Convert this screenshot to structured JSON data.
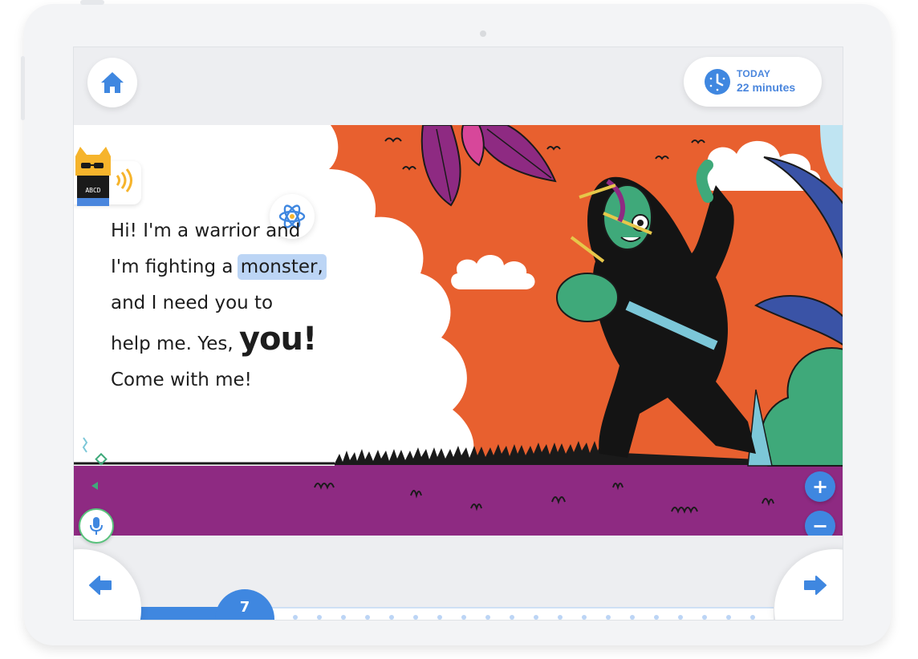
{
  "header": {
    "home_icon": "home-icon",
    "timer": {
      "label": "TODAY",
      "value": "22 minutes",
      "icon": "clock-icon"
    }
  },
  "story": {
    "lines": [
      "Hi! I'm a warrior and",
      "I'm fighting a",
      "and I need you to",
      "help me. Yes,",
      "Come with me!"
    ],
    "highlighted_word": "monster,",
    "emphasis_word": "you!",
    "mascot_text": "ABCD"
  },
  "controls": {
    "zoom_in": "+",
    "zoom_out": "−",
    "mic_icon": "microphone-icon",
    "atom_icon": "atom-icon"
  },
  "footer": {
    "current_page": "7",
    "prev_icon": "arrow-left-icon",
    "next_icon": "arrow-right-icon"
  },
  "colors": {
    "accent": "#3f87e0",
    "sky": "#e8602f",
    "ground": "#8e2a82",
    "highlight": "#bcd5f5",
    "mic_ring": "#58c27c"
  }
}
